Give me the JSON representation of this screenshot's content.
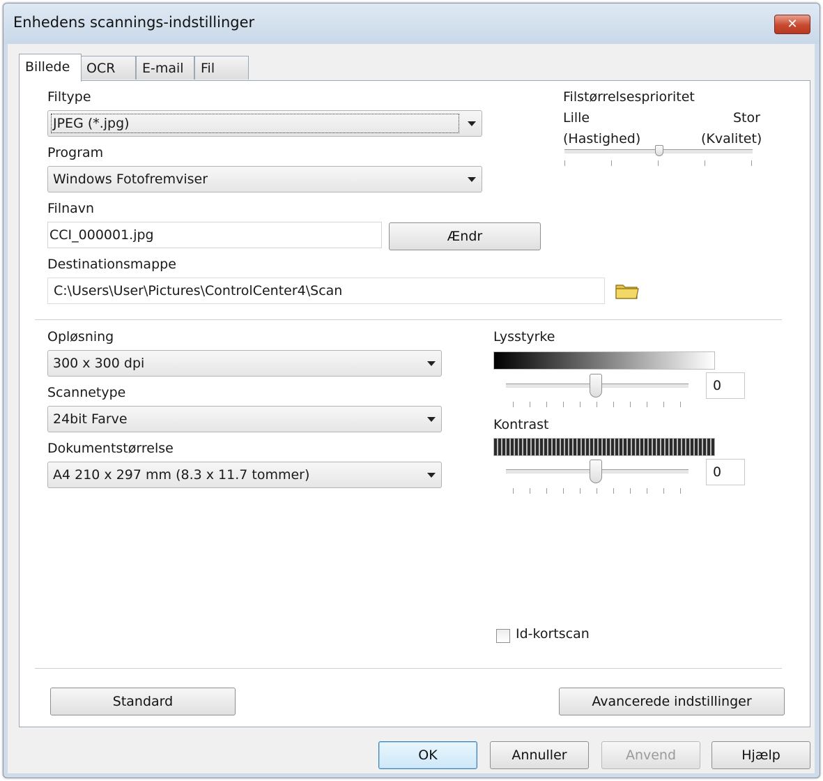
{
  "window": {
    "title": "Enhedens scannings-indstillinger",
    "close_glyph": "✕"
  },
  "tabs": [
    {
      "label": "Billede",
      "active": true
    },
    {
      "label": "OCR",
      "active": false
    },
    {
      "label": "E-mail",
      "active": false
    },
    {
      "label": "Fil",
      "active": false
    }
  ],
  "file_type": {
    "label": "Filtype",
    "value": "JPEG (*.jpg)"
  },
  "program": {
    "label": "Program",
    "value": "Windows Fotofremviser"
  },
  "file_name": {
    "label": "Filnavn",
    "value": "CCI_000001.jpg",
    "change_button": "Ændr"
  },
  "destination": {
    "label": "Destinationsmappe",
    "value": "C:\\Users\\User\\Pictures\\ControlCenter4\\Scan"
  },
  "size_priority": {
    "label": "Filstørrelsesprioritet",
    "left_label": "Lille",
    "left_sub": "(Hastighed)",
    "right_label": "Stor",
    "right_sub": "(Kvalitet)",
    "level": 0.5
  },
  "resolution": {
    "label": "Opløsning",
    "value": "300 x 300 dpi"
  },
  "scan_type": {
    "label": "Scannetype",
    "value": "24bit Farve"
  },
  "document_size": {
    "label": "Dokumentstørrelse",
    "value": "A4 210 x 297 mm (8.3 x 11.7 tommer)"
  },
  "brightness": {
    "label": "Lysstyrke",
    "value": "0",
    "level": 0.5
  },
  "contrast": {
    "label": "Kontrast",
    "value": "0",
    "level": 0.5
  },
  "id_card_scan": {
    "label": "Id-kortscan",
    "checked": false
  },
  "panel_buttons": {
    "standard": "Standard",
    "advanced": "Avancerede indstillinger"
  },
  "dialog_buttons": {
    "ok": "OK",
    "cancel": "Annuller",
    "apply": "Anvend",
    "help": "Hjælp"
  },
  "colors": {
    "title_bar": "#cfdbe8",
    "close_button": "#c8492f",
    "panel": "#ffffff",
    "dialog_bg": "#f0f0f0",
    "folder_icon": "#e8c34a"
  }
}
